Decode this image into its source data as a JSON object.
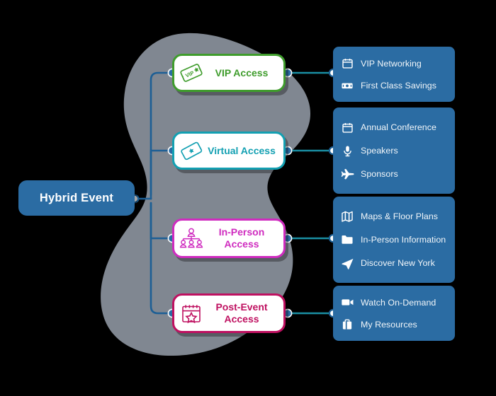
{
  "theme": {
    "background": "#000000",
    "blob_color": "#808791",
    "node_blue": "#2b6ca3",
    "trunk_wire": "#1d5f95",
    "leaf_wire": "#1a8fa3",
    "dot_fill": "#2b6ca3",
    "panel_text": "#f2f6f9",
    "green": "#3f9c2c",
    "teal": "#13a0b2",
    "magenta": "#cf2bbf",
    "crimson": "#bf1060"
  },
  "root": {
    "label": "Hybrid Event"
  },
  "branches": [
    {
      "id": "vip",
      "label": "VIP Access",
      "color": "#3f9c2c",
      "icon": "vip-ticket-icon",
      "details": [
        {
          "label": "VIP Networking",
          "icon": "calendar-icon"
        },
        {
          "label": "First Class Savings",
          "icon": "money-bill-icon"
        }
      ]
    },
    {
      "id": "virtual",
      "label": "Virtual Access",
      "color": "#13a0b2",
      "icon": "star-ticket-icon",
      "details": [
        {
          "label": "Annual Conference",
          "icon": "calendar-icon"
        },
        {
          "label": "Speakers",
          "icon": "microphone-icon"
        },
        {
          "label": "Sponsors",
          "icon": "airplane-icon"
        }
      ]
    },
    {
      "id": "inperson",
      "label": "In-Person Access",
      "color": "#cf2bbf",
      "icon": "org-chart-people-icon",
      "details": [
        {
          "label": "Maps & Floor Plans",
          "icon": "map-icon"
        },
        {
          "label": "In-Person Information",
          "icon": "folder-icon"
        },
        {
          "label": "Discover New York",
          "icon": "navigation-arrow-icon"
        }
      ]
    },
    {
      "id": "postevent",
      "label": "Post-Event Access",
      "color": "#bf1060",
      "icon": "calendar-star-icon",
      "details": [
        {
          "label": "Watch On-Demand",
          "icon": "video-camera-icon"
        },
        {
          "label": "My Resources",
          "icon": "briefcase-icon"
        }
      ]
    }
  ]
}
